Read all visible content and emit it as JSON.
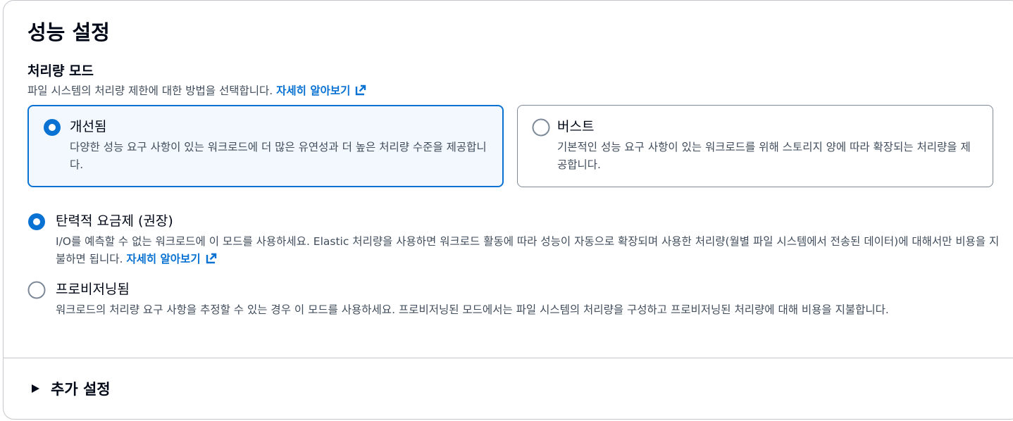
{
  "panel": {
    "title": "성능 설정"
  },
  "throughput": {
    "label": "처리량 모드",
    "description": "파일 시스템의 처리량 제한에 대한 방법을 선택합니다.",
    "learn_more": "자세히 알아보기",
    "tiles": [
      {
        "title": "개선됨",
        "description": "다양한 성능 요구 사항이 있는 워크로드에 더 많은 유연성과 더 높은 처리량 수준을 제공합니다.",
        "selected": true
      },
      {
        "title": "버스트",
        "description": "기본적인 성능 요구 사항이 있는 워크로드를 위해 스토리지 양에 따라 확장되는 처리량을 제공합니다.",
        "selected": false
      }
    ]
  },
  "modes": {
    "elastic": {
      "label": "탄력적 요금제 (권장)",
      "description": "I/O를 예측할 수 없는 워크로드에 이 모드를 사용하세요. Elastic 처리량을 사용하면 워크로드 활동에 따라 성능이 자동으로 확장되며 사용한 처리량(월별 파일 시스템에서 전송된 데이터)에 대해서만 비용을 지불하면 됩니다.",
      "learn_more": "자세히 알아보기",
      "selected": true
    },
    "provisioned": {
      "label": "프로비저닝됨",
      "description": "워크로드의 처리량 요구 사항을 추정할 수 있는 경우 이 모드를 사용하세요. 프로비저닝된 모드에서는 파일 시스템의 처리량을 구성하고 프로비저닝된 처리량에 대해 비용을 지불합니다.",
      "selected": false
    }
  },
  "additional": {
    "label": "추가 설정",
    "expanded": false
  },
  "colors": {
    "accent": "#0972d3",
    "selected_bg": "#f2f8fd",
    "text": "#000716",
    "secondary_text": "#414d5c",
    "border": "#7d8998"
  },
  "icons": {
    "external_link": "external-link-icon",
    "caret": "caret-right-icon"
  }
}
